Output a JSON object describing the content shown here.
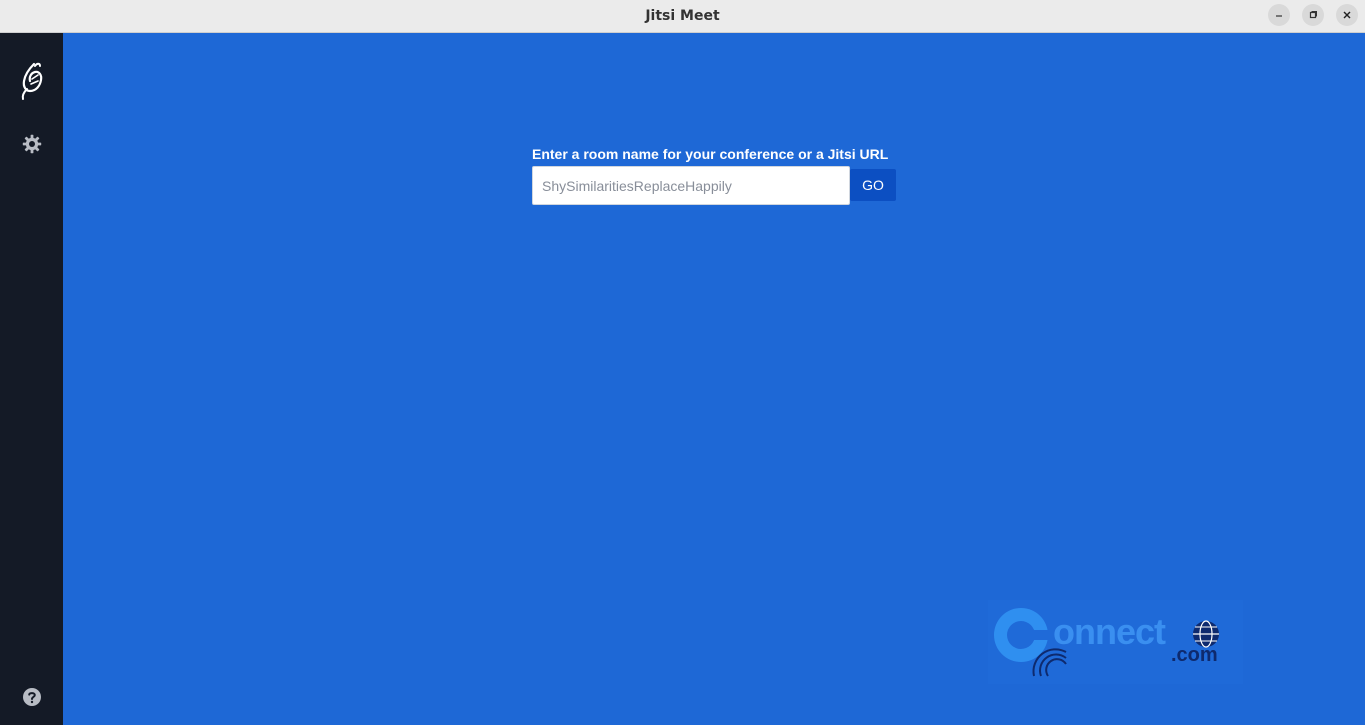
{
  "window": {
    "title": "Jitsi Meet",
    "controls": [
      "minimize-icon",
      "maximize-icon",
      "close-icon"
    ]
  },
  "sidebar": {
    "items": [
      {
        "icon": "jitsi-logo-icon"
      },
      {
        "icon": "gear-icon"
      },
      {
        "icon": "help-icon"
      }
    ]
  },
  "main": {
    "prompt_label": "Enter a room name for your conference or a Jitsi URL",
    "room_input_placeholder": "ShySimilaritiesReplaceHappily",
    "room_input_value": "",
    "go_label": "GO"
  },
  "watermark": {
    "text": "onnect",
    "suffix": ".com"
  },
  "colors": {
    "background": "#1e68d6",
    "sidebar": "#141a26",
    "go_button": "#0c4fc2",
    "titlebar": "#ebebeb"
  }
}
